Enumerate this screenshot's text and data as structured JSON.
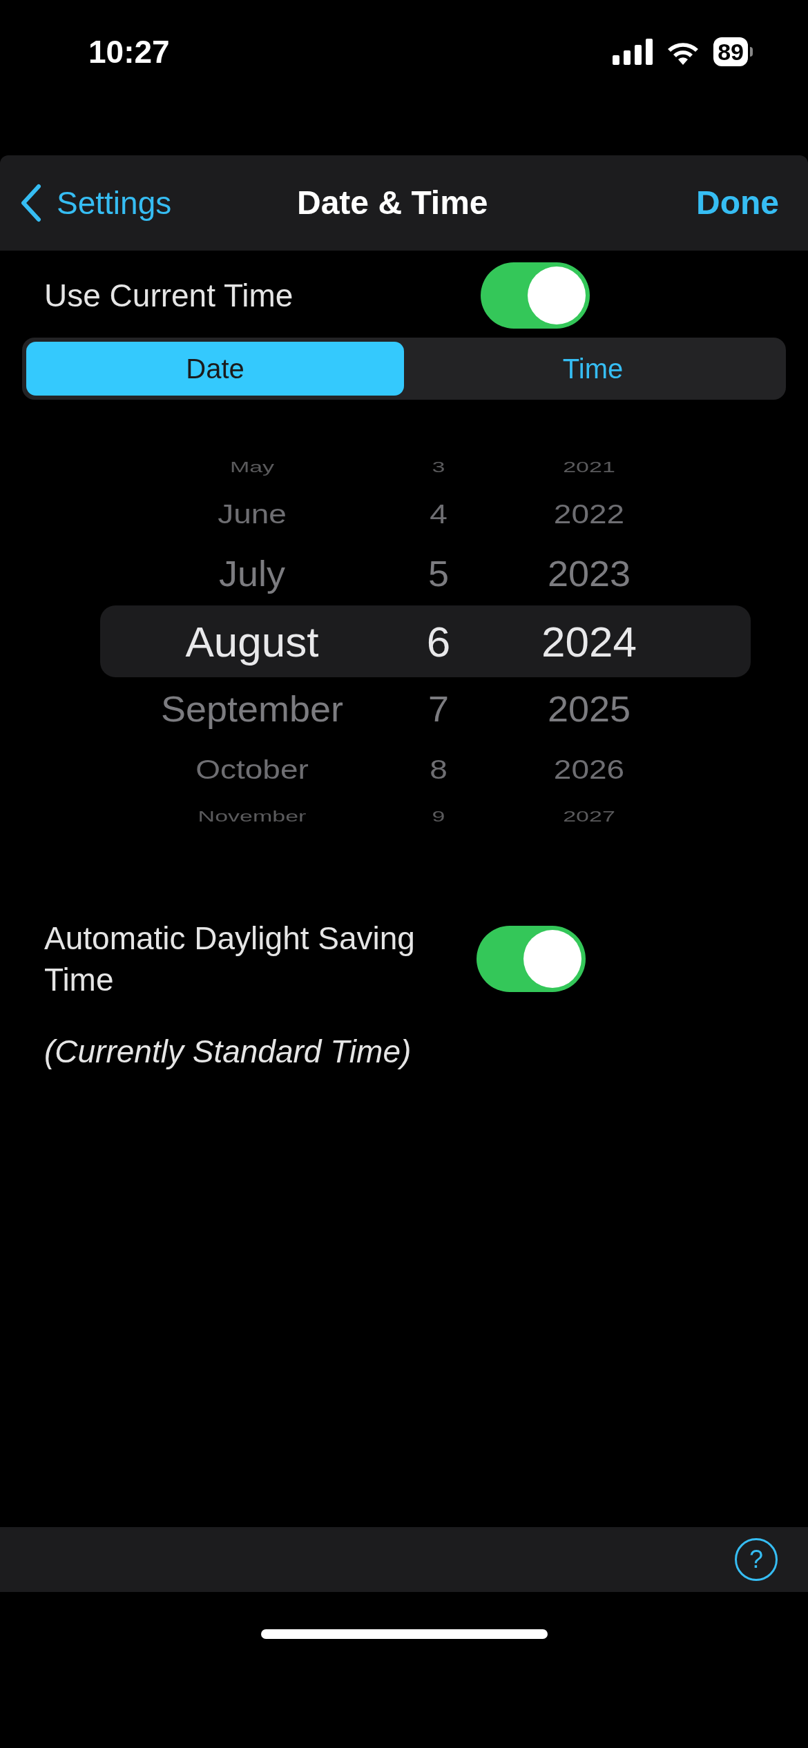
{
  "status_bar": {
    "time": "10:27",
    "battery": "89"
  },
  "nav": {
    "back": "Settings",
    "title": "Date & Time",
    "done": "Done"
  },
  "use_current_time": {
    "label": "Use Current Time",
    "on": true
  },
  "segments": [
    {
      "label": "Date",
      "selected": true
    },
    {
      "label": "Time",
      "selected": false
    }
  ],
  "picker": [
    {
      "month": "May",
      "day": "3",
      "year": "2021",
      "selected": false
    },
    {
      "month": "June",
      "day": "4",
      "year": "2022",
      "selected": false
    },
    {
      "month": "July",
      "day": "5",
      "year": "2023",
      "selected": false
    },
    {
      "month": "August",
      "day": "6",
      "year": "2024",
      "selected": true
    },
    {
      "month": "September",
      "day": "7",
      "year": "2025",
      "selected": false
    },
    {
      "month": "October",
      "day": "8",
      "year": "2026",
      "selected": false
    },
    {
      "month": "November",
      "day": "9",
      "year": "2027",
      "selected": false
    }
  ],
  "daylight_saving": {
    "label": "Automatic Daylight Saving Time",
    "on": true,
    "note": "(Currently Standard Time)"
  },
  "toolbar": {
    "help": "?"
  }
}
